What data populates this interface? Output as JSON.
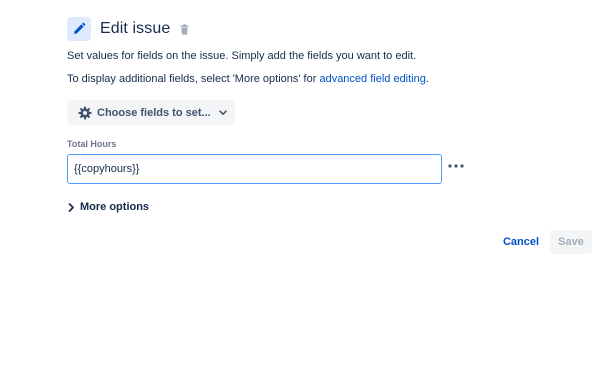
{
  "header": {
    "title": "Edit issue",
    "icon": "pencil-icon",
    "delete_icon": "trash-icon",
    "accent_color": "#0052cc",
    "icon_bg_color": "#deebff"
  },
  "description": {
    "line1": "Set values for fields on the issue. Simply add the fields you want to edit.",
    "line2_prefix": "To display additional fields, select 'More options' for ",
    "line2_link": "advanced field editing",
    "line2_suffix": "."
  },
  "choose_fields": {
    "label": "Choose fields to set...",
    "icon": "gear-icon",
    "chevron": "chevron-down-icon"
  },
  "field": {
    "label": "Total Hours",
    "value": "{{copyhours}}",
    "placeholder": "",
    "border_color": "#4c9aff",
    "more_icon": "more-horizontal-icon"
  },
  "more_options": {
    "label": "More options",
    "icon": "chevron-right-icon"
  },
  "actions": {
    "cancel_label": "Cancel",
    "save_label": "Save",
    "save_disabled": true
  }
}
